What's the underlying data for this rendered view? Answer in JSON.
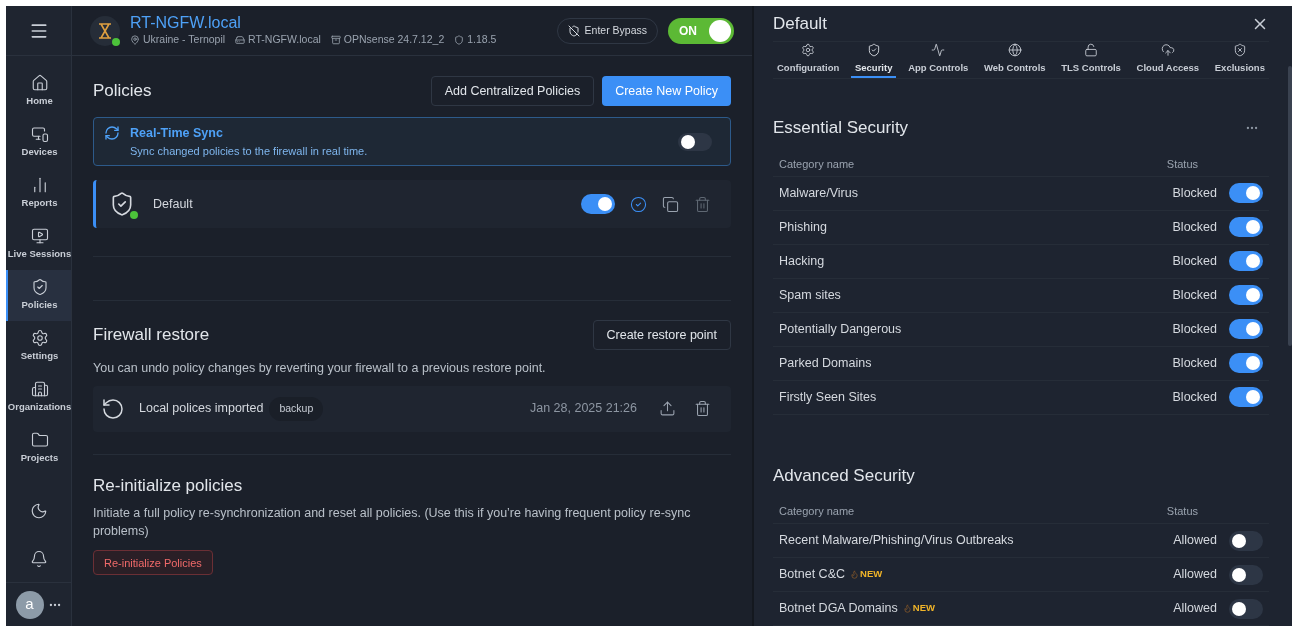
{
  "header": {
    "hostname": "RT-NGFW.local",
    "online": true,
    "location": "Ukraine - Ternopil",
    "device": "RT-NGFW.local",
    "os": "OPNsense 24.7.12_2",
    "version": "1.18.5",
    "bypass_button": "Enter Bypass",
    "power": {
      "label": "ON",
      "on": true
    }
  },
  "sidebar": {
    "items": [
      {
        "label": "Home",
        "selected": false
      },
      {
        "label": "Devices",
        "selected": false
      },
      {
        "label": "Reports",
        "selected": false
      },
      {
        "label": "Live Sessions",
        "selected": false
      },
      {
        "label": "Policies",
        "selected": true
      },
      {
        "label": "Settings",
        "selected": false
      },
      {
        "label": "Organizations",
        "selected": false
      },
      {
        "label": "Projects",
        "selected": false
      }
    ],
    "avatar": "a"
  },
  "policies": {
    "title": "Policies",
    "buttons": [
      "Add Centralized Policies",
      "Create New Policy"
    ],
    "realtime_sync": {
      "title": "Real-Time Sync",
      "description": "Sync changed policies to the firewall in real time.",
      "on": false
    },
    "rows": [
      {
        "name": "Default",
        "enabled": true,
        "online": true,
        "selected": true
      }
    ]
  },
  "firewall_restore": {
    "title": "Firewall restore",
    "button": "Create restore point",
    "description": "You can undo policy changes by reverting your firewall to a previous restore point.",
    "points": [
      {
        "name": "Local polices imported",
        "tag": "backup",
        "date": "Jan 28, 2025 21:26"
      }
    ]
  },
  "reinitialize": {
    "title": "Re-initialize policies",
    "description": "Initiate a full policy re-synchronization and reset all policies. (Use this if you’re having frequent policy re-sync problems)",
    "button": "Re-initialize Policies"
  },
  "panel": {
    "title": "Default",
    "tabs": [
      {
        "label": "Configuration",
        "selected": false
      },
      {
        "label": "Security",
        "selected": true
      },
      {
        "label": "App Controls",
        "selected": false
      },
      {
        "label": "Web Controls",
        "selected": false
      },
      {
        "label": "TLS Controls",
        "selected": false
      },
      {
        "label": "Cloud Access",
        "selected": false
      },
      {
        "label": "Exclusions",
        "selected": false
      }
    ],
    "sections": [
      {
        "title": "Essential Security",
        "columns": [
          "Category name",
          "Status"
        ],
        "rows": [
          {
            "name": "Malware/Virus",
            "status": "Blocked",
            "on": true
          },
          {
            "name": "Phishing",
            "status": "Blocked",
            "on": true
          },
          {
            "name": "Hacking",
            "status": "Blocked",
            "on": true
          },
          {
            "name": "Spam sites",
            "status": "Blocked",
            "on": true
          },
          {
            "name": "Potentially Dangerous",
            "status": "Blocked",
            "on": true
          },
          {
            "name": "Parked Domains",
            "status": "Blocked",
            "on": true
          },
          {
            "name": "Firstly Seen Sites",
            "status": "Blocked",
            "on": true
          }
        ]
      },
      {
        "title": "Advanced Security",
        "columns": [
          "Category name",
          "Status"
        ],
        "rows": [
          {
            "name": "Recent Malware/Phishing/Virus Outbreaks",
            "status": "Allowed",
            "on": false
          },
          {
            "name": "Botnet C&C",
            "badge": "NEW",
            "status": "Allowed",
            "on": false
          },
          {
            "name": "Botnet DGA Domains",
            "badge": "NEW",
            "status": "Allowed",
            "on": false
          }
        ]
      }
    ]
  }
}
